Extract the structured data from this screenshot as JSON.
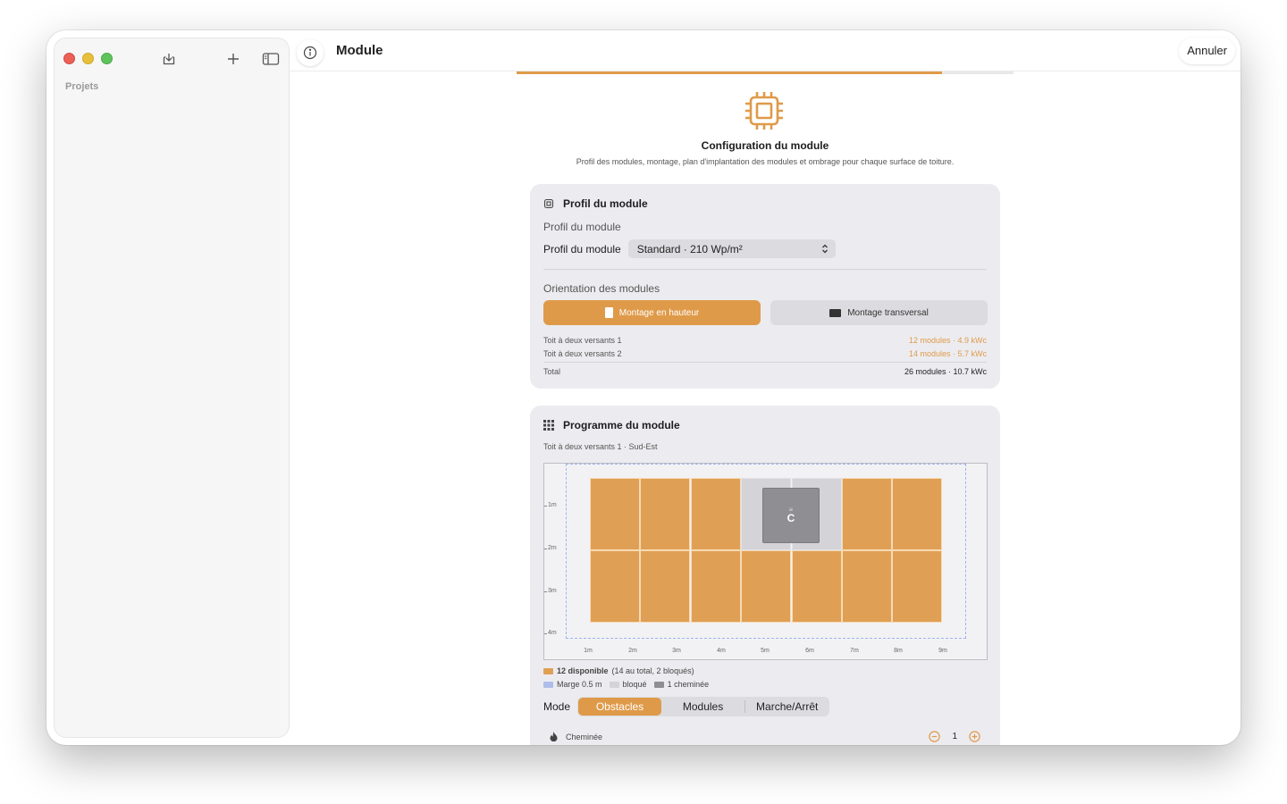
{
  "window": {
    "sidebar": {
      "section_label": "Projets",
      "icons": [
        "download-icon",
        "plus-icon",
        "sidebar-toggle-icon"
      ]
    },
    "toolbar": {
      "title": "Module",
      "cancel_label": "Annuler",
      "info_icon": "info-icon"
    },
    "progress": {
      "fraction": 0.857
    }
  },
  "header": {
    "icon": "chip-icon",
    "title": "Configuration du module",
    "subtitle": "Profil des modules, montage, plan d'implantation des modules et ombrage pour chaque surface de toiture."
  },
  "profile_card": {
    "title": "Profil du module",
    "section_label": "Profil du module",
    "select_label": "Profil du module",
    "select_value": "Standard  ·  210 Wp/m²",
    "orientation_label": "Orientation des modules",
    "buttons": {
      "portrait": "Montage en hauteur",
      "landscape": "Montage transversal"
    },
    "rows": [
      {
        "name": "Toit à deux versants 1",
        "value": "12 modules · 4.9 kWc"
      },
      {
        "name": "Toit à deux versants 2",
        "value": "14 modules · 5.7 kWc"
      }
    ],
    "total": {
      "name": "Total",
      "value": "26 modules · 10.7 kWc"
    }
  },
  "program_card": {
    "title": "Programme du module",
    "roof_label": "Toit à deux versants 1 · Sud-Est",
    "chimney_label": "C",
    "y_ticks": [
      "1m",
      "2m",
      "3m",
      "4m"
    ],
    "x_ticks": [
      "1m",
      "2m",
      "3m",
      "4m",
      "5m",
      "6m",
      "7m",
      "8m",
      "9m"
    ],
    "grid": {
      "rows": 2,
      "cols": 7,
      "blocked": [
        [
          0,
          3
        ],
        [
          0,
          4
        ]
      ]
    },
    "legend": {
      "available_bold": "12 disponible",
      "available_rest": "(14 au total, 2 bloqués)",
      "margin": "Marge 0.5 m",
      "blocked": "bloqué",
      "chimney": "1 cheminée"
    },
    "colors": {
      "module": "#dfa055",
      "margin": "#aebde9",
      "blocked": "#d4d4d8",
      "chimney": "#8e8e93",
      "accent": "#df9a49"
    },
    "mode_label": "Mode",
    "modes": [
      "Obstacles",
      "Modules",
      "Marche/Arrêt"
    ],
    "selected_mode": "Obstacles",
    "obstacle": {
      "name": "Cheminée",
      "count": "1"
    }
  }
}
